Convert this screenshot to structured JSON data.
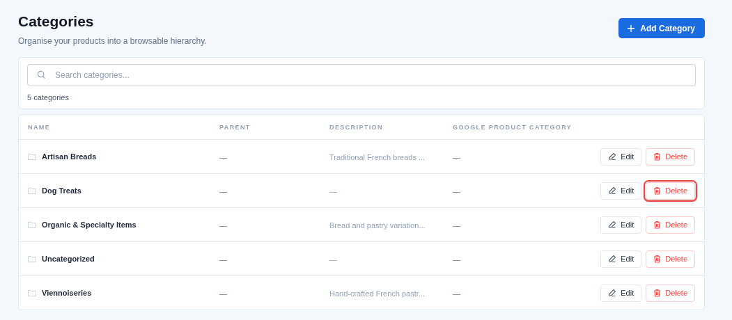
{
  "header": {
    "title": "Categories",
    "subtitle": "Organise your products into a browsable hierarchy.",
    "add_button": "Add Category"
  },
  "search": {
    "placeholder": "Search categories...",
    "count": "5 categories"
  },
  "table": {
    "columns": [
      "NAME",
      "PARENT",
      "DESCRIPTION",
      "GOOGLE PRODUCT CATEGORY"
    ],
    "rows": [
      {
        "name": "Artisan Breads",
        "parent": "—",
        "description": "Traditional French breads ...",
        "google_category": "—",
        "edit": "Edit",
        "delete": "Delete",
        "highlighted": false
      },
      {
        "name": "Dog Treats",
        "parent": "—",
        "description": "—",
        "google_category": "—",
        "edit": "Edit",
        "delete": "Delete",
        "highlighted": true
      },
      {
        "name": "Organic & Specialty Items",
        "parent": "—",
        "description": "Bread and pastry variation...",
        "google_category": "—",
        "edit": "Edit",
        "delete": "Delete",
        "highlighted": false
      },
      {
        "name": "Uncategorized",
        "parent": "—",
        "description": "—",
        "google_category": "—",
        "edit": "Edit",
        "delete": "Delete",
        "highlighted": false
      },
      {
        "name": "Viennoiseries",
        "parent": "—",
        "description": "Hand-crafted French pastr...",
        "google_category": "—",
        "edit": "Edit",
        "delete": "Delete",
        "highlighted": false
      }
    ]
  }
}
